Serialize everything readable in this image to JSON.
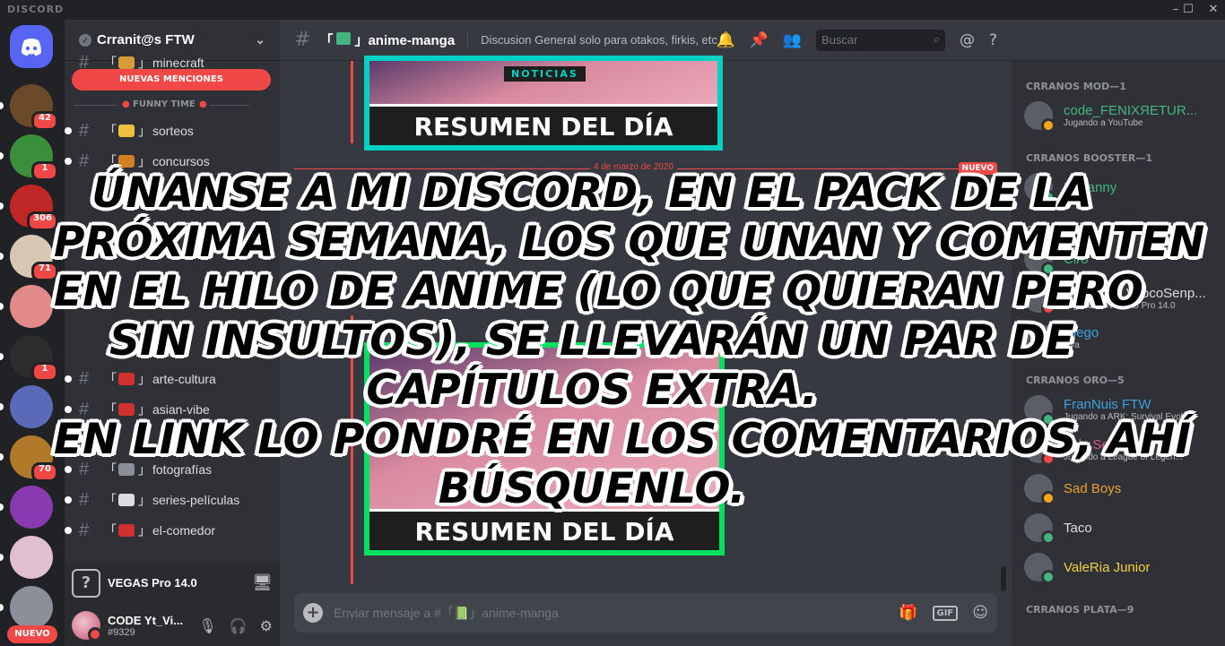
{
  "app": {
    "brand": "DISCORD",
    "window_controls": [
      "–",
      "☐",
      "✕"
    ]
  },
  "rail": {
    "servers": [
      {
        "name": "server-stream",
        "badge": "42",
        "color": "#6b4a2a"
      },
      {
        "name": "server-crrnotas",
        "badge": "1",
        "color": "#3b8f3b"
      },
      {
        "name": "server-x",
        "badge": "306",
        "color": "#c02828"
      },
      {
        "name": "server-guy",
        "badge": "71",
        "color": "#d9c7b4"
      },
      {
        "name": "server-anime-girls",
        "badge": "",
        "color": "#e28a8a"
      },
      {
        "name": "server-dog",
        "badge": "1",
        "color": "#2c2c2c"
      },
      {
        "name": "server-victoria",
        "badge": "",
        "color": "#5a6ab8"
      },
      {
        "name": "server-game",
        "badge": "70",
        "color": "#b07a2a"
      },
      {
        "name": "server-fortnite-llama",
        "badge": "",
        "color": "#8a3ab0"
      },
      {
        "name": "server-blossom",
        "badge": "",
        "color": "#e0c0d0"
      },
      {
        "name": "server-gray-anime",
        "badge": "",
        "color": "#8a8f99"
      }
    ],
    "new_label": "NUEVO"
  },
  "sidebar": {
    "guild_name": "Crranit@s FTW",
    "mentions_pill": "NUEVAS MENCIONES",
    "category_funny": "FUNNY TIME",
    "channels": [
      {
        "label": "minecraft",
        "color": "#d99a3a"
      },
      {
        "label": "sorteos",
        "color": "#f0c040"
      },
      {
        "label": "concursos",
        "color": "#d08020"
      },
      {
        "label": "arte-cultura",
        "color": "#d03030"
      },
      {
        "label": "asian-vibe",
        "color": "#d03030"
      },
      {
        "label": "fotografías",
        "color": "#8a8f99"
      },
      {
        "label": "series-películas",
        "color": "#dcddde"
      },
      {
        "label": "el-comedor",
        "color": "#d03030"
      }
    ],
    "activity": "VEGAS Pro 14.0",
    "user": {
      "name": "CODE Yt_Vi...",
      "tag": "#9329"
    }
  },
  "main": {
    "channel_name": "anime-manga",
    "topic": "Discusion General solo para otakos, firkis, etc",
    "search_placeholder": "Buscar",
    "banner_text": "RESUMEN DEL DÍA",
    "banner_small": "NOTICIAS",
    "divider_date": "4 de marzo de 2020",
    "divider_new": "NUEVO",
    "composer_placeholder": "Enviar mensaje a #「📗」anime-manga",
    "gif_label": "GIF"
  },
  "members": {
    "groups": [
      {
        "label": "CRRANOS MOD—1",
        "members": [
          {
            "name": "code_FENIXЯETUR...",
            "color": "#43b581",
            "activity": "Jugando a YouTube",
            "status": "#faa61a"
          }
        ]
      },
      {
        "label": "CRRANOS BOOSTER—1",
        "members": [
          {
            "name": "LzDanny",
            "color": "#43b581",
            "activity": "",
            "status": "#43b581"
          }
        ]
      },
      {
        "label": "CRRANOS ABDUCIDOS—3",
        "members": [
          {
            "name": "Ciro",
            "color": "#43b581",
            "activity": "",
            "status": "#43b581"
          },
          {
            "name": "CODE Yt_VitocoSenp...",
            "color": "#dcddde",
            "activity": "Jugando a VEGAS Pro 14.0",
            "status": "#f04747"
          },
          {
            "name": "Diego",
            "color": "#3ca0e0",
            "activity": "Cya",
            "status": "#43b581"
          }
        ]
      },
      {
        "label": "CRRANOS ORO—5",
        "members": [
          {
            "name": "FranNuis FTW",
            "color": "#3ca0e0",
            "activity": "Jugando a ARK: Survival Evolv...",
            "status": "#43b581"
          },
          {
            "name": "Lola Sempai ♡",
            "color": "#e05a8a",
            "activity": "Jugando a League of Legen...",
            "status": "#f04747"
          },
          {
            "name": "Sad Boys",
            "color": "#f0a030",
            "activity": "",
            "status": "#faa61a"
          },
          {
            "name": "Taco",
            "color": "#dcddde",
            "activity": "",
            "status": "#43b581"
          },
          {
            "name": "ValeRia Junior",
            "color": "#f0d040",
            "activity": "",
            "status": "#43b581"
          }
        ]
      },
      {
        "label": "CRRANOS PLATA—9",
        "members": []
      }
    ]
  },
  "overlay": {
    "lines": [
      "ÚNANSE A MI DISCORD, EN EL PACK DE LA",
      "PRÓXIMA SEMANA, LOS QUE UNAN Y COMENTEN",
      "EN EL HILO DE ANIME (LO QUE QUIERAN PERO",
      "SIN INSULTOS), SE LLEVARÁN UN PAR DE",
      "CAPÍTULOS EXTRA.",
      "EN LINK LO PONDRÉ EN LOS COMENTARIOS, AHÍ",
      "BÚSQUENLO."
    ]
  }
}
